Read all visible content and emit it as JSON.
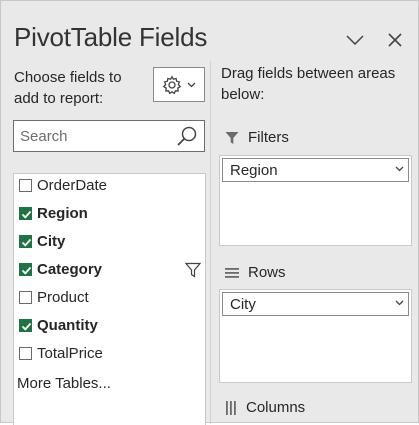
{
  "panel": {
    "title": "PivotTable Fields",
    "dropdown_icon": "chevron-down-icon",
    "close_icon": "close-icon"
  },
  "left": {
    "choose_text": "Choose fields to add to report:",
    "tools_icon": "gear-icon",
    "search": {
      "placeholder": "Search",
      "value": ""
    },
    "fields": [
      {
        "label": "OrderDate",
        "checked": false,
        "bold": false,
        "filtered": false
      },
      {
        "label": "Region",
        "checked": true,
        "bold": true,
        "filtered": false
      },
      {
        "label": "City",
        "checked": true,
        "bold": true,
        "filtered": false
      },
      {
        "label": "Category",
        "checked": true,
        "bold": true,
        "filtered": true
      },
      {
        "label": "Product",
        "checked": false,
        "bold": false,
        "filtered": false
      },
      {
        "label": "Quantity",
        "checked": true,
        "bold": true,
        "filtered": false
      },
      {
        "label": "TotalPrice",
        "checked": false,
        "bold": false,
        "filtered": false
      }
    ],
    "more_tables": "More Tables..."
  },
  "right": {
    "drag_text": "Drag fields between areas below:",
    "areas": {
      "filters": {
        "label": "Filters",
        "icon": "filter-icon",
        "items": [
          "Region"
        ]
      },
      "rows": {
        "label": "Rows",
        "icon": "rows-icon",
        "items": [
          "City"
        ]
      },
      "columns": {
        "label": "Columns",
        "icon": "columns-icon",
        "items": []
      }
    }
  },
  "colors": {
    "check_green": "#217346",
    "pane_bg": "#e9e9e9"
  }
}
